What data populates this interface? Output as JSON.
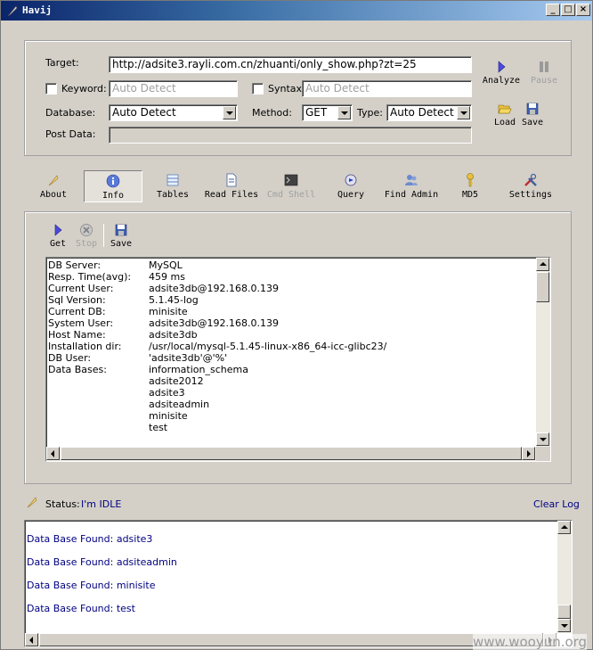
{
  "window": {
    "title": "Havij"
  },
  "form": {
    "target_label": "Target:",
    "target_value": "http://adsite3.rayli.com.cn/zhuanti/only_show.php?zt=25",
    "keyword_label": "Keyword:",
    "keyword_value": "Auto Detect",
    "syntax_label": "Syntax:",
    "syntax_value": "Auto Detect",
    "database_label": "Database:",
    "database_value": "Auto Detect",
    "method_label": "Method:",
    "method_value": "GET",
    "type_label": "Type:",
    "type_value": "Auto Detect",
    "postdata_label": "Post Data:",
    "analyze_label": "Analyze",
    "pause_label": "Pause",
    "load_label": "Load",
    "save_label": "Save"
  },
  "toolbar": {
    "about": "About",
    "info": "Info",
    "tables": "Tables",
    "read_files": "Read Files",
    "cmd_shell": "Cmd Shell",
    "query": "Query",
    "find_admin": "Find Admin",
    "md5": "MD5",
    "settings": "Settings"
  },
  "info_panel": {
    "get_label": "Get",
    "stop_label": "Stop",
    "save_label": "Save",
    "rows": [
      {
        "key": "DB Server:",
        "value": "MySQL"
      },
      {
        "key": "Resp. Time(avg):",
        "value": "459 ms"
      },
      {
        "key": "Current User:",
        "value": "adsite3db@192.168.0.139"
      },
      {
        "key": "Sql Version:",
        "value": "5.1.45-log"
      },
      {
        "key": "Current DB:",
        "value": "minisite"
      },
      {
        "key": "System User:",
        "value": "adsite3db@192.168.0.139"
      },
      {
        "key": "Host Name:",
        "value": "adsite3db"
      },
      {
        "key": "Installation dir:",
        "value": "/usr/local/mysql-5.1.45-linux-x86_64-icc-glibc23/"
      },
      {
        "key": "DB User:",
        "value": "'adsite3db'@'%'"
      },
      {
        "key": "Data Bases:",
        "value": "information_schema"
      },
      {
        "key": "",
        "value": "adsite2012"
      },
      {
        "key": "",
        "value": "adsite3"
      },
      {
        "key": "",
        "value": "adsiteadmin"
      },
      {
        "key": "",
        "value": "minisite"
      },
      {
        "key": "",
        "value": "test"
      }
    ]
  },
  "status": {
    "label": "Status:",
    "value": "I'm IDLE",
    "clear_log": "Clear Log"
  },
  "log": {
    "lines": [
      "Data Base Found: adsite3",
      "Data Base Found: adsiteadmin",
      "Data Base Found: minisite",
      "Data Base Found: test"
    ]
  },
  "watermark": "www.wooyun.org",
  "colors": {
    "titlebar": "#0a246a",
    "link": "#000080",
    "face": "#d4d0c8"
  }
}
